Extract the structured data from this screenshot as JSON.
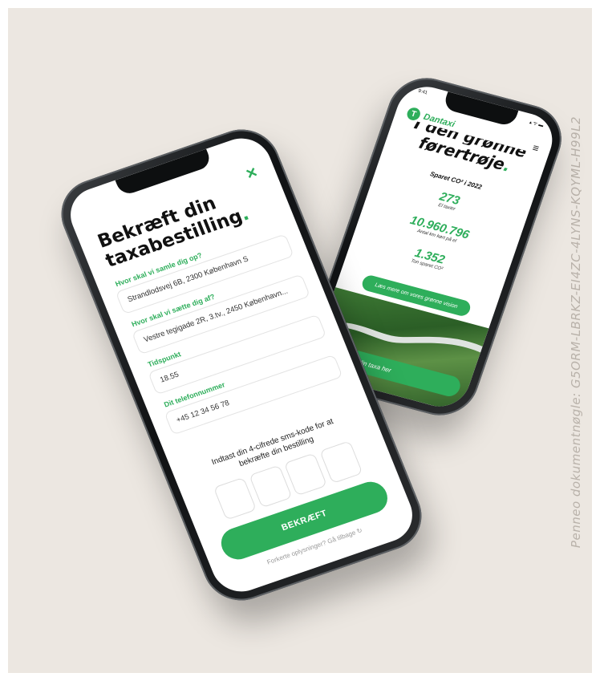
{
  "watermark": "Penneo dokumentnøgle: G5ORM-LBRKZ-EI4ZC-4LYNS-KQYML-H99L2",
  "booking": {
    "close": "×",
    "title": "Bekræft din taxabestilling",
    "title_dot": ".",
    "pickup_label": "Hvor skal vi samle dig op?",
    "pickup_value": "Strandlodsvej 6B, 2300 København S",
    "dropoff_label": "Hvor skal vi sætte dig af?",
    "dropoff_value": "Vestre tegigade 2R, 3.tv., 2450 København...",
    "time_label": "Tidspunkt",
    "time_value": "18.55",
    "phone_label": "Dit telefonnummer",
    "phone_value": "+45 12 34 56 78",
    "sms_prompt": "Indtast din 4-cifrede sms-kode for at bekræfte din bestilling",
    "confirm": "BEKRÆFT",
    "back_link": "Forkerte oplysninger? Gå tilbage"
  },
  "site": {
    "time": "9:41",
    "status_icons": "▴ ᯤ ▬",
    "logo_mark": "T",
    "logo": "Dantaxi",
    "menu": "≡",
    "heading_top": "I den grønne",
    "heading": "førertrøje",
    "heading_dot": ".",
    "subheading": "Sparet CO² i 2022",
    "stats": [
      {
        "value": "273",
        "label": "El taxier"
      },
      {
        "value": "10.960.796",
        "label": "Antal km kørt på el"
      },
      {
        "value": "1.352",
        "label": "Ton sparet CO²"
      }
    ],
    "vision_button": "Læs mere om vores grønne vision",
    "cta": "Bestil din taxa her"
  },
  "colors": {
    "accent": "#2eae5b",
    "background": "#ece7e1"
  }
}
